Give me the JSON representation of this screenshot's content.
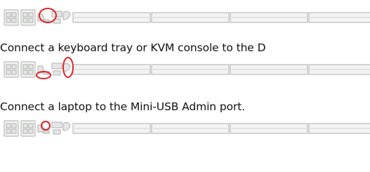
{
  "steps": [
    {
      "caption": "",
      "highlight_target": "network-port",
      "highlight_color": "#e0242c"
    },
    {
      "caption": "Connect a keyboard tray or KVM console to the D",
      "highlight_target": "local-console-ports",
      "highlight_color": "#e0242c"
    },
    {
      "caption": "Connect a laptop to the Mini-USB Admin port.",
      "highlight_target": "mini-usb-admin-port",
      "highlight_color": "#e0242c"
    }
  ],
  "colors": {
    "device_stroke": "#b9bcb9",
    "device_fill": "#f4f4f4",
    "port_fill": "#e8e8e6",
    "highlight": "#e0242c"
  }
}
